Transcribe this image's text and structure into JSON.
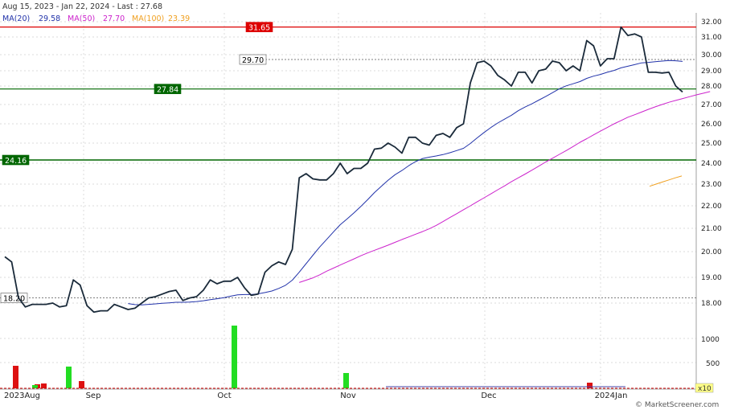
{
  "header": {
    "title": "Aug 15, 2023 - Jan 22, 2024 - Last : 27.68",
    "ma20_label": "MA(20)",
    "ma20_value": "29.58",
    "ma50_label": "MA(50)",
    "ma50_value": "27.70",
    "ma100_label": "MA(100)",
    "ma100_value": "23.39"
  },
  "colors": {
    "price": "#1a2a3a",
    "ma20": "#2233aa",
    "ma50": "#cc22cc",
    "ma100": "#f0a020",
    "level_red": "#dd0000",
    "level_green": "#006600",
    "grid": "#cfcfcf",
    "vol_up": "#22dd22",
    "vol_down": "#dd1111"
  },
  "footer": {
    "credit": "© MarketScreener.com",
    "multiplier": "x10"
  },
  "chart_data": {
    "type": "line",
    "y_ticks": [
      "32.00",
      "31.00",
      "30.00",
      "29.00",
      "28.00",
      "27.00",
      "26.00",
      "25.00",
      "24.00",
      "23.00",
      "22.00",
      "21.00",
      "20.00",
      "19.00",
      "18.00"
    ],
    "x_ticks": [
      "2023Aug",
      "Sep",
      "Oct",
      "Nov",
      "Dec",
      "2024Jan"
    ],
    "ylim": [
      18,
      32
    ],
    "levels": [
      {
        "label": "31.65",
        "value": 31.65,
        "style": "red"
      },
      {
        "label": "29.70",
        "value": 29.7,
        "style": "dashed"
      },
      {
        "label": "27.84",
        "value": 27.84,
        "style": "green"
      },
      {
        "label": "24.16",
        "value": 24.16,
        "style": "darkgreen"
      },
      {
        "label": "18.20",
        "value": 18.2,
        "style": "dashed"
      }
    ],
    "series": [
      {
        "name": "price",
        "values": [
          19.8,
          19.6,
          18.2,
          17.85,
          17.95,
          17.95,
          17.95,
          18.0,
          17.85,
          17.9,
          18.9,
          18.7,
          17.9,
          17.65,
          17.7,
          17.7,
          17.95,
          17.85,
          17.75,
          17.8,
          18.0,
          18.2,
          18.25,
          18.35,
          18.45,
          18.5,
          18.1,
          18.2,
          18.25,
          18.5,
          18.9,
          18.75,
          18.85,
          18.85,
          19.0,
          18.6,
          18.3,
          18.35,
          19.2,
          19.45,
          19.6,
          19.5,
          20.1,
          23.3,
          23.5,
          23.25,
          23.2,
          23.2,
          23.5,
          24.0,
          23.5,
          23.75,
          23.75,
          24.0,
          24.7,
          24.75,
          25.0,
          24.8,
          24.5,
          25.3,
          25.3,
          25.0,
          24.9,
          25.4,
          25.5,
          25.3,
          25.8,
          26.0,
          28.2,
          29.5,
          29.6,
          29.3,
          28.7,
          28.4,
          28.0,
          28.9,
          28.9,
          28.2,
          29.0,
          29.1,
          29.6,
          29.5,
          29.0,
          29.3,
          29.0,
          30.8,
          30.5,
          29.3,
          29.75,
          29.75,
          31.65,
          31.1,
          31.2,
          31.0,
          28.9,
          28.9,
          28.85,
          28.9,
          28.0,
          27.68
        ]
      },
      {
        "name": "MA(20)",
        "values": [
          null,
          null,
          null,
          null,
          null,
          null,
          null,
          null,
          null,
          null,
          null,
          null,
          null,
          null,
          null,
          null,
          null,
          null,
          17.98,
          17.94,
          17.93,
          17.95,
          17.97,
          17.99,
          18.01,
          18.03,
          18.03,
          18.04,
          18.06,
          18.09,
          18.13,
          18.17,
          18.21,
          18.27,
          18.32,
          18.33,
          18.33,
          18.36,
          18.41,
          18.47,
          18.57,
          18.69,
          18.89,
          19.2,
          19.53,
          19.86,
          20.2,
          20.52,
          20.84,
          21.16,
          21.42,
          21.69,
          21.97,
          22.28,
          22.61,
          22.9,
          23.19,
          23.45,
          23.65,
          23.88,
          24.08,
          24.23,
          24.3,
          24.36,
          24.43,
          24.52,
          24.63,
          24.74,
          24.98,
          25.27,
          25.55,
          25.81,
          26.04,
          26.24,
          26.44,
          26.68,
          26.87,
          27.04,
          27.24,
          27.43,
          27.64,
          27.85,
          28.01,
          28.15,
          28.29,
          28.5,
          28.65,
          28.76,
          28.9,
          29.02,
          29.18,
          29.28,
          29.38,
          29.49,
          29.52,
          29.56,
          29.6,
          29.64,
          29.62,
          29.58
        ]
      },
      {
        "name": "MA(50)",
        "values": [
          null,
          null,
          null,
          null,
          null,
          null,
          null,
          null,
          null,
          null,
          null,
          null,
          null,
          null,
          null,
          null,
          null,
          null,
          null,
          null,
          null,
          null,
          null,
          null,
          null,
          null,
          null,
          null,
          null,
          null,
          null,
          null,
          null,
          null,
          null,
          null,
          null,
          null,
          null,
          null,
          null,
          null,
          null,
          null,
          null,
          null,
          null,
          null,
          null,
          18.8,
          18.89,
          18.98,
          19.1,
          19.24,
          19.36,
          19.48,
          19.6,
          19.72,
          19.84,
          19.95,
          20.06,
          20.17,
          20.28,
          20.4,
          20.52,
          20.63,
          20.75,
          20.86,
          20.98,
          21.13,
          21.3,
          21.48,
          21.65,
          21.83,
          22.0,
          22.19,
          22.37,
          22.55,
          22.74,
          22.92,
          23.12,
          23.3,
          23.48,
          23.67,
          23.86,
          24.06,
          24.25,
          24.44,
          24.63,
          24.83,
          25.04,
          25.23,
          25.43,
          25.62,
          25.81,
          26.0,
          26.17,
          26.34,
          26.47,
          26.61,
          26.75,
          26.88,
          27.0,
          27.12,
          27.22,
          27.32,
          27.42,
          27.52,
          27.61,
          27.7
        ]
      },
      {
        "name": "MA(100)",
        "values": [
          22.9,
          23.0,
          23.1,
          23.2,
          23.3,
          23.39
        ]
      }
    ],
    "volume": {
      "up": [
        0,
        0,
        1,
        0,
        2,
        0,
        0,
        3,
        0,
        0,
        1,
        0
      ],
      "down": [
        2,
        1,
        0,
        1,
        0,
        1,
        0,
        0,
        0,
        0,
        0,
        1
      ]
    }
  }
}
